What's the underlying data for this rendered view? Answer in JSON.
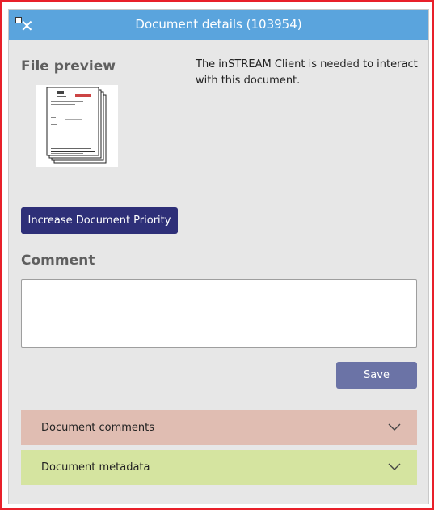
{
  "header": {
    "title": "Document details (103954)"
  },
  "preview": {
    "title": "File preview",
    "client_note": "The inSTREAM Client is needed to interact with this document."
  },
  "actions": {
    "increase_priority_label": "Increase Document Priority",
    "save_label": "Save"
  },
  "comment": {
    "title": "Comment",
    "value": "",
    "placeholder": ""
  },
  "accordions": [
    {
      "label": "Document comments",
      "color": "#e0bdb2",
      "icon": "chevron-down-icon"
    },
    {
      "label": "Document metadata",
      "color": "#d5e4a0",
      "icon": "chevron-down-icon"
    }
  ],
  "colors": {
    "header": "#5aa4dd",
    "primary_button": "#2e2f78",
    "save_button": "#6b73a6",
    "frame_border": "#e8202a"
  }
}
